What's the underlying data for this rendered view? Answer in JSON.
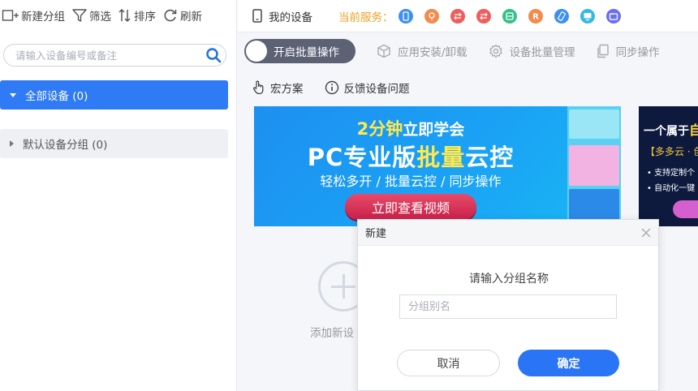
{
  "left_toolbar": {
    "new_group": "新建分组",
    "filter": "筛选",
    "sort": "排序",
    "refresh": "刷新"
  },
  "search": {
    "placeholder": "请输入设备编号或备注"
  },
  "groups": [
    {
      "label": "全部设备 (0)",
      "active": true
    },
    {
      "label": "默认设备分组 (0)",
      "active": false
    }
  ],
  "topbar": {
    "my_device": "我的设备",
    "service_label": "当前服务：",
    "services": [
      {
        "icon": "phone-icon",
        "color": "#3d8ff5"
      },
      {
        "icon": "location-icon",
        "color": "#f28b4b"
      },
      {
        "icon": "transfer-icon",
        "color": "#ef5d5d"
      },
      {
        "icon": "exchange-icon",
        "color": "#ef5d5d"
      },
      {
        "icon": "app-icon",
        "color": "#35c08a"
      },
      {
        "icon": "root-icon",
        "color": "#f28b4b"
      },
      {
        "icon": "rotate-icon",
        "color": "#3d8ff5"
      },
      {
        "icon": "screen-icon",
        "color": "#35b7e8"
      },
      {
        "icon": "folder-icon",
        "color": "#6a6ff0"
      }
    ]
  },
  "actions": {
    "batch": "开启批量操作",
    "install": "应用安装/卸载",
    "manage": "设备批量管理",
    "sync": "同步操作"
  },
  "links": {
    "macro": "宏方案",
    "feedback": "反馈设备问题"
  },
  "banner1": {
    "line1_accent": "2分钟",
    "line1_rest": "立即学会",
    "title_a": "PC专业版",
    "title_accent": "批量",
    "title_b": "云控",
    "sub": "轻松多开 / 批量云控 / 同步操作",
    "cta": "立即查看视频"
  },
  "banner2": {
    "title_a": "一个属于",
    "title_accent": "自",
    "sub": "【多多云 · 创",
    "bullet1": "• 支持定制个",
    "bullet2": "• 自动化一键"
  },
  "add_device": {
    "label": "添加新设"
  },
  "dialog": {
    "title": "新建",
    "prompt": "请输入分组名称",
    "placeholder": "分组别名",
    "cancel": "取消",
    "ok": "确定"
  }
}
